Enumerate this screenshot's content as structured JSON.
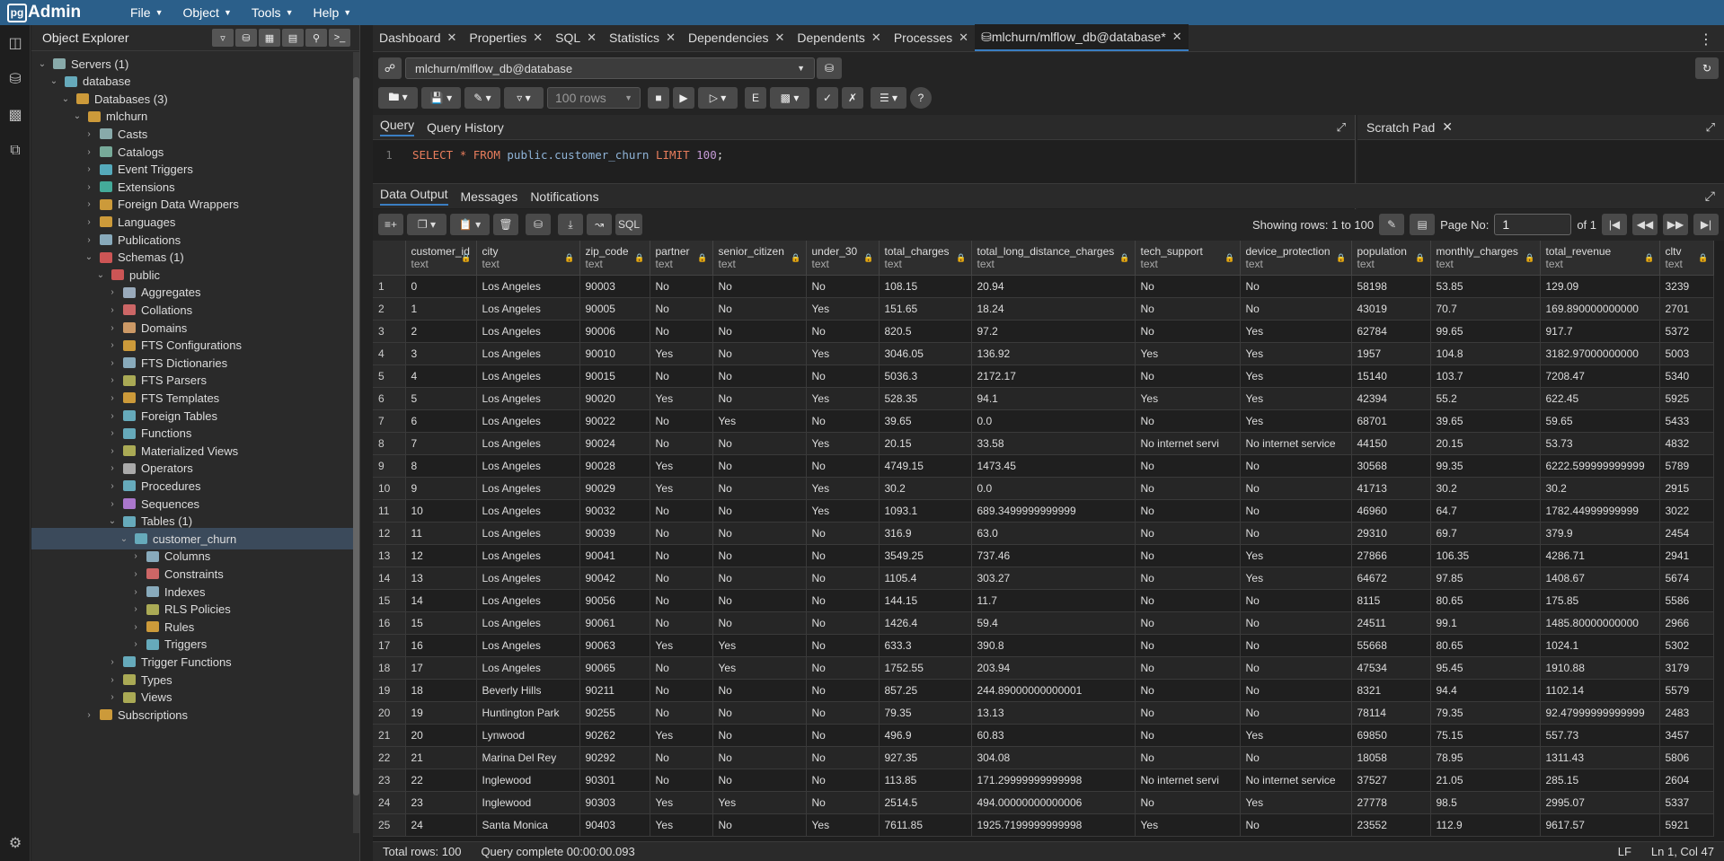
{
  "app": {
    "logo_pg": "pg",
    "logo_admin": "Admin"
  },
  "menu": [
    "File",
    "Object",
    "Tools",
    "Help"
  ],
  "explorer": {
    "title": "Object Explorer",
    "tree": [
      {
        "label": "Servers (1)",
        "depth": 0,
        "icon": "#8aa"
      },
      {
        "label": "database",
        "depth": 1,
        "icon": "#6ab"
      },
      {
        "label": "Databases (3)",
        "depth": 2,
        "icon": "#cc9a3a"
      },
      {
        "label": "mlchurn",
        "depth": 3,
        "icon": "#cc9a3a"
      },
      {
        "label": "Casts",
        "depth": 4,
        "icon": "#8aa"
      },
      {
        "label": "Catalogs",
        "depth": 4,
        "icon": "#7a9"
      },
      {
        "label": "Event Triggers",
        "depth": 4,
        "icon": "#5ab"
      },
      {
        "label": "Extensions",
        "depth": 4,
        "icon": "#4a9"
      },
      {
        "label": "Foreign Data Wrappers",
        "depth": 4,
        "icon": "#cc9a3a"
      },
      {
        "label": "Languages",
        "depth": 4,
        "icon": "#cc9a3a"
      },
      {
        "label": "Publications",
        "depth": 4,
        "icon": "#8ab"
      },
      {
        "label": "Schemas (1)",
        "depth": 4,
        "icon": "#c55"
      },
      {
        "label": "public",
        "depth": 5,
        "icon": "#c55"
      },
      {
        "label": "Aggregates",
        "depth": 6,
        "icon": "#9ab"
      },
      {
        "label": "Collations",
        "depth": 6,
        "icon": "#c66"
      },
      {
        "label": "Domains",
        "depth": 6,
        "icon": "#c96"
      },
      {
        "label": "FTS Configurations",
        "depth": 6,
        "icon": "#cc9a3a"
      },
      {
        "label": "FTS Dictionaries",
        "depth": 6,
        "icon": "#8ab"
      },
      {
        "label": "FTS Parsers",
        "depth": 6,
        "icon": "#aa5"
      },
      {
        "label": "FTS Templates",
        "depth": 6,
        "icon": "#cc9a3a"
      },
      {
        "label": "Foreign Tables",
        "depth": 6,
        "icon": "#6ab"
      },
      {
        "label": "Functions",
        "depth": 6,
        "icon": "#6ab"
      },
      {
        "label": "Materialized Views",
        "depth": 6,
        "icon": "#aa5"
      },
      {
        "label": "Operators",
        "depth": 6,
        "icon": "#aaa"
      },
      {
        "label": "Procedures",
        "depth": 6,
        "icon": "#6ab"
      },
      {
        "label": "Sequences",
        "depth": 6,
        "icon": "#a7c"
      },
      {
        "label": "Tables (1)",
        "depth": 6,
        "icon": "#6ab"
      },
      {
        "label": "customer_churn",
        "depth": 7,
        "icon": "#6ab",
        "selected": true
      },
      {
        "label": "Columns",
        "depth": 8,
        "icon": "#8ab"
      },
      {
        "label": "Constraints",
        "depth": 8,
        "icon": "#c66"
      },
      {
        "label": "Indexes",
        "depth": 8,
        "icon": "#8ab"
      },
      {
        "label": "RLS Policies",
        "depth": 8,
        "icon": "#aa5"
      },
      {
        "label": "Rules",
        "depth": 8,
        "icon": "#cc9a3a"
      },
      {
        "label": "Triggers",
        "depth": 8,
        "icon": "#6ab"
      },
      {
        "label": "Trigger Functions",
        "depth": 6,
        "icon": "#6ab"
      },
      {
        "label": "Types",
        "depth": 6,
        "icon": "#aa5"
      },
      {
        "label": "Views",
        "depth": 6,
        "icon": "#aa5"
      },
      {
        "label": "Subscriptions",
        "depth": 4,
        "icon": "#cc9a3a"
      }
    ]
  },
  "tabs": [
    {
      "label": "Dashboard"
    },
    {
      "label": "Properties"
    },
    {
      "label": "SQL"
    },
    {
      "label": "Statistics"
    },
    {
      "label": "Dependencies"
    },
    {
      "label": "Dependents"
    },
    {
      "label": "Processes"
    },
    {
      "label": "mlchurn/mlflow_db@database*",
      "active": true
    }
  ],
  "connection": "mlchurn/mlflow_db@database",
  "rows_select": "100 rows",
  "query_tabs": [
    "Query",
    "Query History"
  ],
  "scratch_title": "Scratch Pad",
  "editor": {
    "line": "1",
    "kw1": "SELECT",
    "star": "*",
    "kw2": "FROM",
    "table": "public.customer_churn",
    "kw3": "LIMIT",
    "limit": "100",
    "end": ";"
  },
  "output_tabs": [
    "Data Output",
    "Messages",
    "Notifications"
  ],
  "pager": {
    "showing": "Showing rows: 1 to 100",
    "page_label": "Page No:",
    "page": "1",
    "of": "of 1"
  },
  "sql_btn": "SQL",
  "columns": [
    {
      "name": "customer_id",
      "type": "text",
      "w": 79
    },
    {
      "name": "city",
      "type": "text",
      "w": 115
    },
    {
      "name": "zip_code",
      "type": "text",
      "w": 78
    },
    {
      "name": "partner",
      "type": "text",
      "w": 70
    },
    {
      "name": "senior_citizen",
      "type": "text",
      "w": 104
    },
    {
      "name": "under_30",
      "type": "text",
      "w": 81
    },
    {
      "name": "total_charges",
      "type": "text",
      "w": 103
    },
    {
      "name": "total_long_distance_charges",
      "type": "text",
      "w": 182
    },
    {
      "name": "tech_support",
      "type": "text",
      "w": 117
    },
    {
      "name": "device_protection",
      "type": "text",
      "w": 124
    },
    {
      "name": "population",
      "type": "text",
      "w": 88
    },
    {
      "name": "monthly_charges",
      "type": "text",
      "w": 122
    },
    {
      "name": "total_revenue",
      "type": "text",
      "w": 133
    },
    {
      "name": "cltv",
      "type": "text",
      "w": 60
    }
  ],
  "rows": [
    [
      "1",
      "0",
      "Los Angeles",
      "90003",
      "No",
      "No",
      "No",
      "108.15",
      "20.94",
      "No",
      "No",
      "58198",
      "53.85",
      "129.09",
      "3239"
    ],
    [
      "2",
      "1",
      "Los Angeles",
      "90005",
      "No",
      "No",
      "Yes",
      "151.65",
      "18.24",
      "No",
      "No",
      "43019",
      "70.7",
      "169.890000000000",
      "2701"
    ],
    [
      "3",
      "2",
      "Los Angeles",
      "90006",
      "No",
      "No",
      "No",
      "820.5",
      "97.2",
      "No",
      "Yes",
      "62784",
      "99.65",
      "917.7",
      "5372"
    ],
    [
      "4",
      "3",
      "Los Angeles",
      "90010",
      "Yes",
      "No",
      "Yes",
      "3046.05",
      "136.92",
      "Yes",
      "Yes",
      "1957",
      "104.8",
      "3182.97000000000",
      "5003"
    ],
    [
      "5",
      "4",
      "Los Angeles",
      "90015",
      "No",
      "No",
      "No",
      "5036.3",
      "2172.17",
      "No",
      "Yes",
      "15140",
      "103.7",
      "7208.47",
      "5340"
    ],
    [
      "6",
      "5",
      "Los Angeles",
      "90020",
      "Yes",
      "No",
      "Yes",
      "528.35",
      "94.1",
      "Yes",
      "Yes",
      "42394",
      "55.2",
      "622.45",
      "5925"
    ],
    [
      "7",
      "6",
      "Los Angeles",
      "90022",
      "No",
      "Yes",
      "No",
      "39.65",
      "0.0",
      "No",
      "Yes",
      "68701",
      "39.65",
      "59.65",
      "5433"
    ],
    [
      "8",
      "7",
      "Los Angeles",
      "90024",
      "No",
      "No",
      "Yes",
      "20.15",
      "33.58",
      "No internet servi",
      "No internet service",
      "44150",
      "20.15",
      "53.73",
      "4832"
    ],
    [
      "9",
      "8",
      "Los Angeles",
      "90028",
      "Yes",
      "No",
      "No",
      "4749.15",
      "1473.45",
      "No",
      "No",
      "30568",
      "99.35",
      "6222.599999999999",
      "5789"
    ],
    [
      "10",
      "9",
      "Los Angeles",
      "90029",
      "Yes",
      "No",
      "Yes",
      "30.2",
      "0.0",
      "No",
      "No",
      "41713",
      "30.2",
      "30.2",
      "2915"
    ],
    [
      "11",
      "10",
      "Los Angeles",
      "90032",
      "No",
      "No",
      "Yes",
      "1093.1",
      "689.3499999999999",
      "No",
      "No",
      "46960",
      "64.7",
      "1782.44999999999",
      "3022"
    ],
    [
      "12",
      "11",
      "Los Angeles",
      "90039",
      "No",
      "No",
      "No",
      "316.9",
      "63.0",
      "No",
      "No",
      "29310",
      "69.7",
      "379.9",
      "2454"
    ],
    [
      "13",
      "12",
      "Los Angeles",
      "90041",
      "No",
      "No",
      "No",
      "3549.25",
      "737.46",
      "No",
      "Yes",
      "27866",
      "106.35",
      "4286.71",
      "2941"
    ],
    [
      "14",
      "13",
      "Los Angeles",
      "90042",
      "No",
      "No",
      "No",
      "1105.4",
      "303.27",
      "No",
      "Yes",
      "64672",
      "97.85",
      "1408.67",
      "5674"
    ],
    [
      "15",
      "14",
      "Los Angeles",
      "90056",
      "No",
      "No",
      "No",
      "144.15",
      "11.7",
      "No",
      "No",
      "8115",
      "80.65",
      "175.85",
      "5586"
    ],
    [
      "16",
      "15",
      "Los Angeles",
      "90061",
      "No",
      "No",
      "No",
      "1426.4",
      "59.4",
      "No",
      "No",
      "24511",
      "99.1",
      "1485.80000000000",
      "2966"
    ],
    [
      "17",
      "16",
      "Los Angeles",
      "90063",
      "Yes",
      "Yes",
      "No",
      "633.3",
      "390.8",
      "No",
      "No",
      "55668",
      "80.65",
      "1024.1",
      "5302"
    ],
    [
      "18",
      "17",
      "Los Angeles",
      "90065",
      "No",
      "Yes",
      "No",
      "1752.55",
      "203.94",
      "No",
      "No",
      "47534",
      "95.45",
      "1910.88",
      "3179"
    ],
    [
      "19",
      "18",
      "Beverly Hills",
      "90211",
      "No",
      "No",
      "No",
      "857.25",
      "244.89000000000001",
      "No",
      "No",
      "8321",
      "94.4",
      "1102.14",
      "5579"
    ],
    [
      "20",
      "19",
      "Huntington Park",
      "90255",
      "No",
      "No",
      "No",
      "79.35",
      "13.13",
      "No",
      "No",
      "78114",
      "79.35",
      "92.47999999999999",
      "2483"
    ],
    [
      "21",
      "20",
      "Lynwood",
      "90262",
      "Yes",
      "No",
      "No",
      "496.9",
      "60.83",
      "No",
      "Yes",
      "69850",
      "75.15",
      "557.73",
      "3457"
    ],
    [
      "22",
      "21",
      "Marina Del Rey",
      "90292",
      "No",
      "No",
      "No",
      "927.35",
      "304.08",
      "No",
      "No",
      "18058",
      "78.95",
      "1311.43",
      "5806"
    ],
    [
      "23",
      "22",
      "Inglewood",
      "90301",
      "No",
      "No",
      "No",
      "113.85",
      "171.29999999999998",
      "No internet servi",
      "No internet service",
      "37527",
      "21.05",
      "285.15",
      "2604"
    ],
    [
      "24",
      "23",
      "Inglewood",
      "90303",
      "Yes",
      "Yes",
      "No",
      "2514.5",
      "494.00000000000006",
      "No",
      "Yes",
      "27778",
      "98.5",
      "2995.07",
      "5337"
    ],
    [
      "25",
      "24",
      "Santa Monica",
      "90403",
      "Yes",
      "No",
      "Yes",
      "7611.85",
      "1925.7199999999998",
      "Yes",
      "No",
      "23552",
      "112.9",
      "9617.57",
      "5921"
    ]
  ],
  "status": {
    "total": "Total rows: 100",
    "query": "Query complete 00:00:00.093",
    "eol": "LF",
    "pos": "Ln 1, Col 47"
  }
}
